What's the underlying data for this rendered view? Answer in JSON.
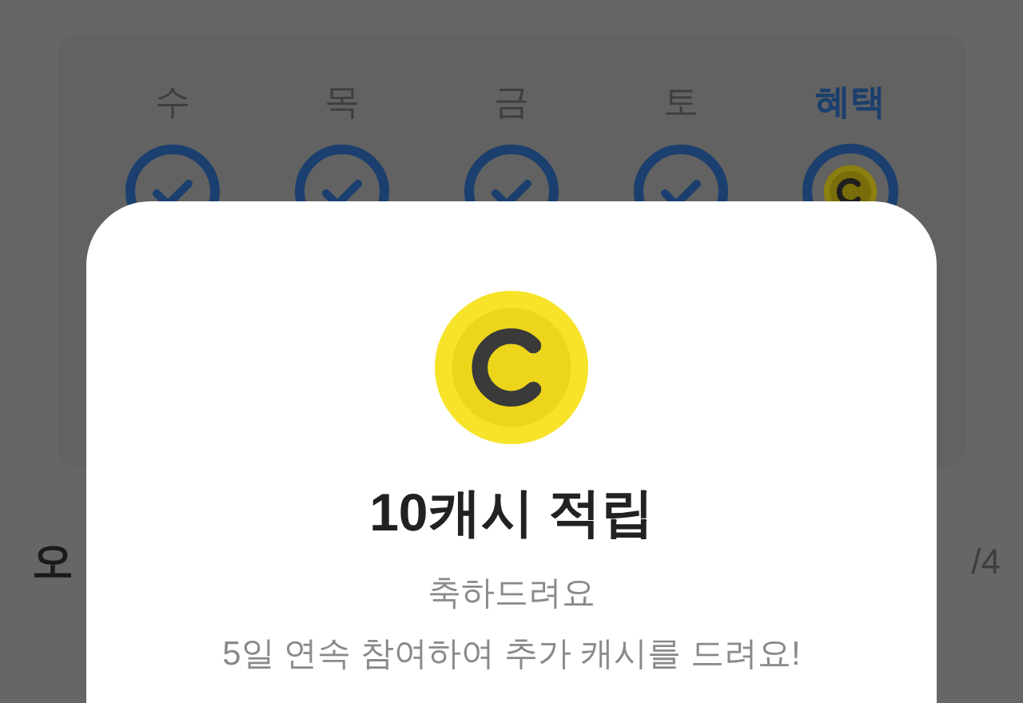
{
  "days": [
    {
      "label": "수",
      "kind": "check",
      "selected": false
    },
    {
      "label": "목",
      "kind": "check",
      "selected": false
    },
    {
      "label": "금",
      "kind": "check",
      "selected": false
    },
    {
      "label": "토",
      "kind": "check",
      "selected": false
    },
    {
      "label": "혜택",
      "kind": "coin",
      "selected": true
    }
  ],
  "behind": {
    "left_text": "오",
    "right_text": "/4"
  },
  "modal": {
    "title": "10캐시 적립",
    "message": "축하드려요",
    "detail": "5일 연속 참여하여 추가 캐시를 드려요!"
  }
}
